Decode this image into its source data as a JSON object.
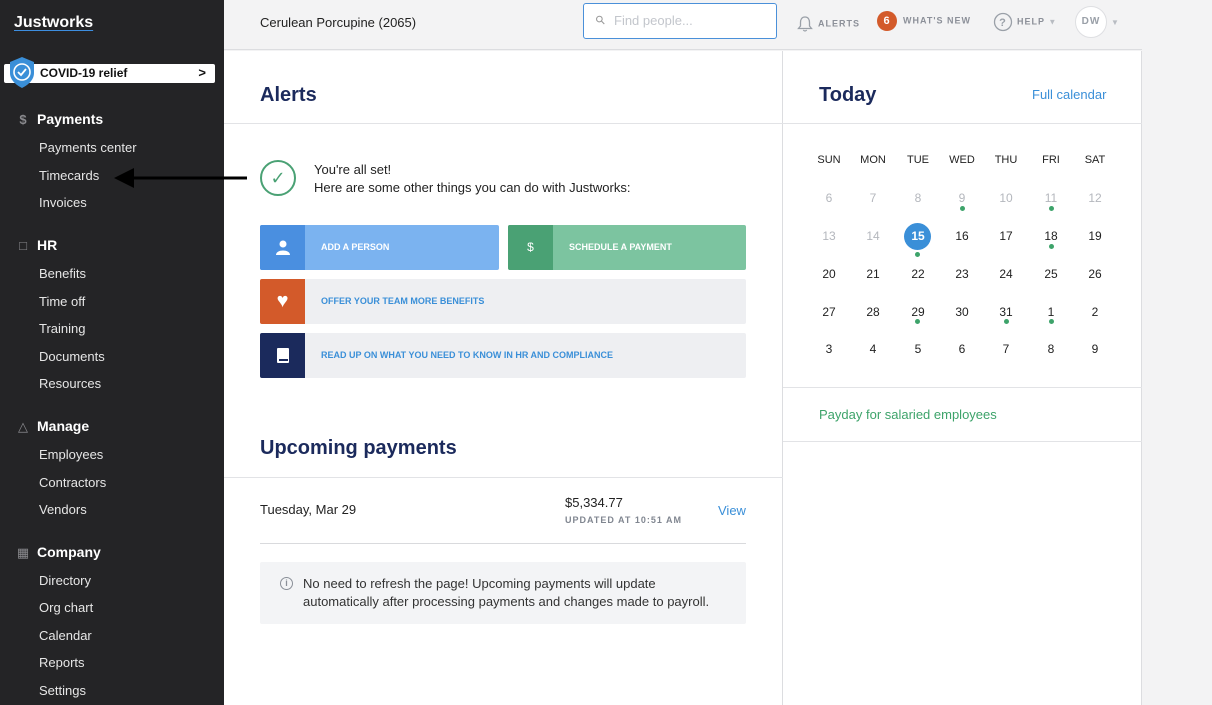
{
  "sidebar": {
    "logo": "Justworks",
    "covid_label": "COVID-19 relief",
    "sections": [
      {
        "title": "Payments",
        "icon": "dollar-icon",
        "items": [
          "Payments center",
          "Timecards",
          "Invoices"
        ]
      },
      {
        "title": "HR",
        "icon": "clipboard-icon",
        "items": [
          "Benefits",
          "Time off",
          "Training",
          "Documents",
          "Resources"
        ]
      },
      {
        "title": "Manage",
        "icon": "people-icon",
        "items": [
          "Employees",
          "Contractors",
          "Vendors"
        ]
      },
      {
        "title": "Company",
        "icon": "building-icon",
        "items": [
          "Directory",
          "Org chart",
          "Calendar",
          "Reports",
          "Settings"
        ]
      }
    ]
  },
  "topbar": {
    "company": "Cerulean Porcupine (2065)",
    "search_placeholder": "Find people...",
    "alerts_label": "ALERTS",
    "whats_new_count": "6",
    "whats_new_label": "WHAT'S NEW",
    "help_label": "HELP",
    "avatar_initials": "DW"
  },
  "alerts": {
    "title": "Alerts",
    "line1": "You're all set!",
    "line2": "Here are some other things you can do with Justworks:",
    "actions": {
      "add_person": "ADD A PERSON",
      "schedule_payment": "SCHEDULE A PAYMENT",
      "offer_benefits": "OFFER YOUR TEAM MORE BENEFITS",
      "read_up": "READ UP ON WHAT YOU NEED TO KNOW IN HR AND COMPLIANCE"
    }
  },
  "upcoming": {
    "title": "Upcoming payments",
    "date": "Tuesday, Mar 29",
    "amount": "$5,334.77",
    "updated": "UPDATED AT 10:51 AM",
    "view": "View",
    "info": "No need to refresh the page! Upcoming payments will update automatically after processing payments and changes made to payroll."
  },
  "today": {
    "title": "Today",
    "full_calendar": "Full calendar",
    "weekdays": [
      "SUN",
      "MON",
      "TUE",
      "WED",
      "THU",
      "FRI",
      "SAT"
    ],
    "weeks": [
      [
        "6",
        "7",
        "8",
        "9",
        "10",
        "11",
        "12"
      ],
      [
        "13",
        "14",
        "15",
        "16",
        "17",
        "18",
        "19"
      ],
      [
        "20",
        "21",
        "22",
        "23",
        "24",
        "25",
        "26"
      ],
      [
        "27",
        "28",
        "29",
        "30",
        "31",
        "1",
        "2"
      ],
      [
        "3",
        "4",
        "5",
        "6",
        "7",
        "8",
        "9"
      ]
    ],
    "payday": "Payday for salaried employees"
  },
  "colors": {
    "sidebar_bg": "#242426",
    "accent_blue": "#3a8fd8",
    "accent_green": "#3da36a",
    "navy": "#1b2a5c",
    "badge_orange": "#d35a2a"
  }
}
